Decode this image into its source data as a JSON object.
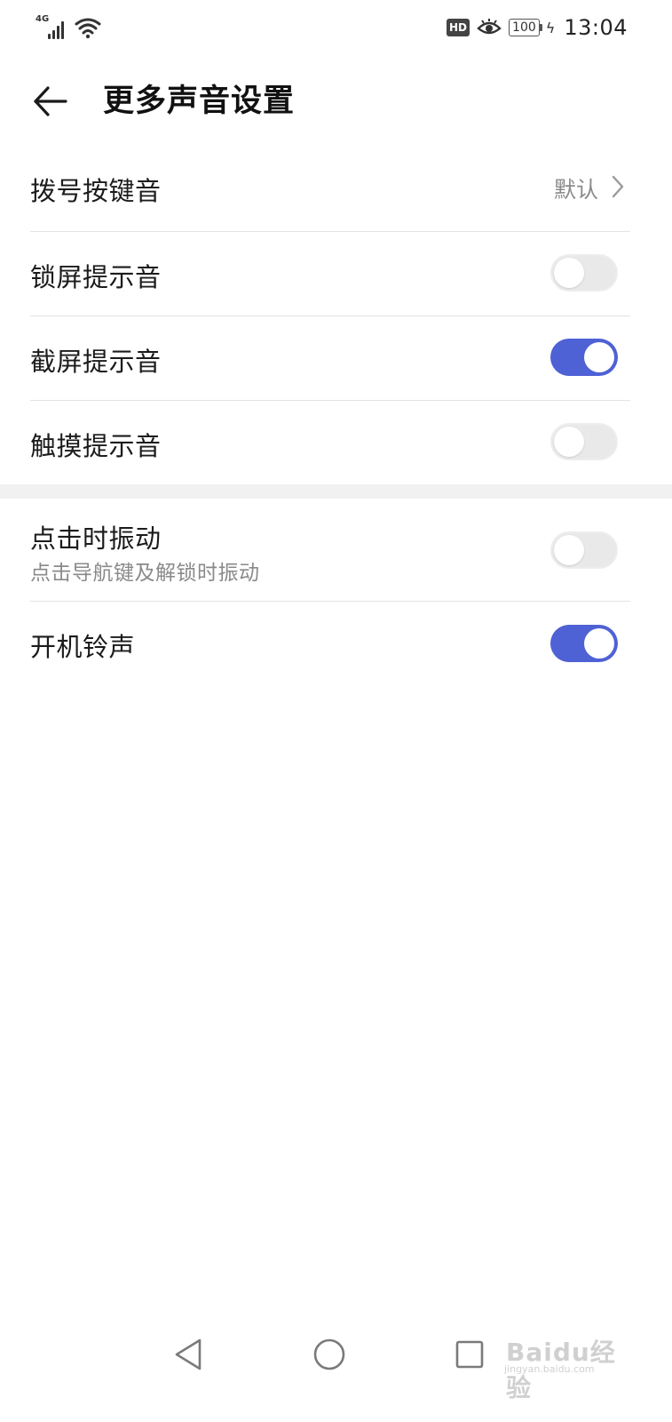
{
  "status_bar": {
    "network_label": "4G",
    "hd_badge": "HD",
    "battery_level": "100",
    "time": "13:04"
  },
  "header": {
    "title": "更多声音设置"
  },
  "settings": {
    "dial_tone": {
      "label": "拨号按键音",
      "value": "默认"
    },
    "lock_tone": {
      "label": "锁屏提示音",
      "enabled": false
    },
    "screenshot_tone": {
      "label": "截屏提示音",
      "enabled": true
    },
    "touch_tone": {
      "label": "触摸提示音",
      "enabled": false
    },
    "vibrate_on_tap": {
      "label": "点击时振动",
      "sublabel": "点击导航键及解锁时振动",
      "enabled": false
    },
    "boot_ringtone": {
      "label": "开机铃声",
      "enabled": true
    }
  },
  "colors": {
    "toggle_on": "#4e61d5",
    "toggle_off": "#e9e9e9"
  },
  "watermark": {
    "text": "Baidu经验",
    "sub": "jingyan.baidu.com"
  }
}
